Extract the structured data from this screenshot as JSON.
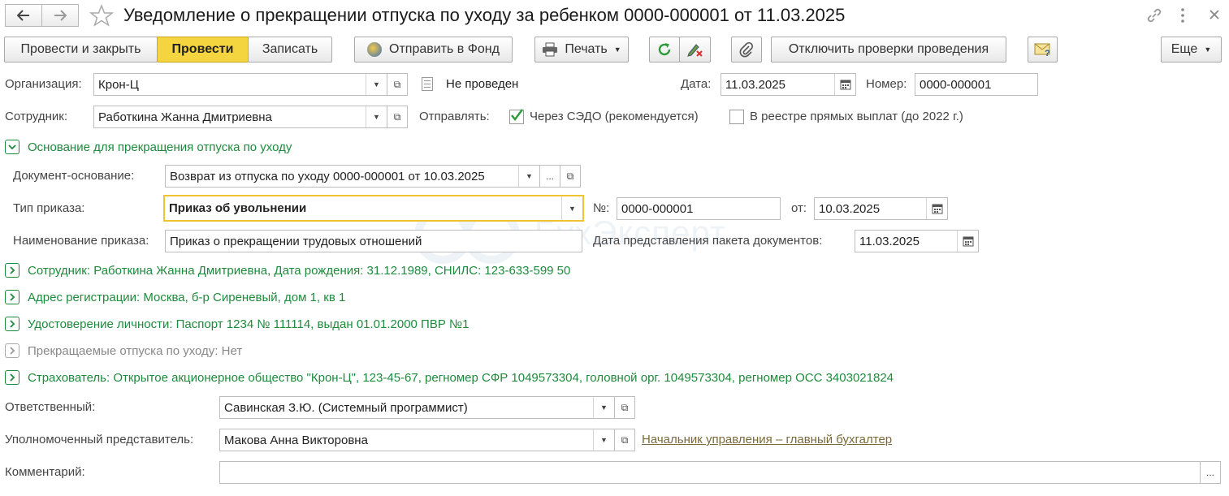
{
  "header": {
    "title": "Уведомление о прекращении отпуска по уходу за ребенком 0000-000001 от 11.03.2025"
  },
  "toolbar": {
    "post_close": "Провести и закрыть",
    "post": "Провести",
    "save": "Записать",
    "send_fund": "Отправить в Фонд",
    "print": "Печать",
    "disable_checks": "Отключить проверки проведения",
    "more": "Еще"
  },
  "form": {
    "org_label": "Организация:",
    "org_value": "Крон-Ц",
    "status_text": "Не проведен",
    "date_label": "Дата:",
    "date_value": "11.03.2025",
    "number_label": "Номер:",
    "number_value": "0000-000001",
    "employee_label": "Сотрудник:",
    "employee_value": "Работкина Жанна Дмитриевна",
    "send_label": "Отправлять:",
    "send_sedo": "Через СЭДО (рекомендуется)",
    "send_registry": "В реестре прямых выплат (до 2022 г.)"
  },
  "basis": {
    "group_title": "Основание для прекращения отпуска по уходу",
    "doc_label": "Документ-основание:",
    "doc_value": "Возврат из отпуска по уходу 0000-000001 от 10.03.2025",
    "order_type_label": "Тип приказа:",
    "order_type_value": "Приказ об увольнении",
    "no_label": "№:",
    "no_value": "0000-000001",
    "from_label": "от:",
    "from_value": "10.03.2025",
    "order_name_label": "Наименование приказа:",
    "order_name_value": "Приказ о прекращении трудовых отношений",
    "pack_date_label": "Дата представления пакета документов:",
    "pack_date_value": "11.03.2025"
  },
  "groups": {
    "employee": "Сотрудник: Работкина Жанна Дмитриевна, Дата рождения: 31.12.1989, СНИЛС: 123-633-599 50",
    "address": "Адрес регистрации: Москва, б-р Сиреневый, дом 1, кв 1",
    "identity": "Удостоверение личности: Паспорт 1234 № 111114, выдан 01.01.2000 ПВР №1",
    "leaves": "Прекращаемые отпуска по уходу: Нет",
    "insurer": "Страхователь: Открытое акционерное общество \"Крон-Ц\", 123-45-67, регномер СФР 1049573304, головной орг. 1049573304, регномер ОСС 3403021824"
  },
  "footer": {
    "responsible_label": "Ответственный:",
    "responsible_value": "Савинская З.Ю. (Системный программист)",
    "rep_label": "Уполномоченный представитель:",
    "rep_value": "Макова Анна Викторовна",
    "rep_position": "Начальник управления – главный бухгалтер",
    "comment_label": "Комментарий:",
    "comment_value": ""
  },
  "watermark": "БухЭксперт",
  "colors": {
    "accent_yellow": "#f5d53f",
    "group_green": "#1e8a3c",
    "link_brown": "#7a6a3a"
  }
}
